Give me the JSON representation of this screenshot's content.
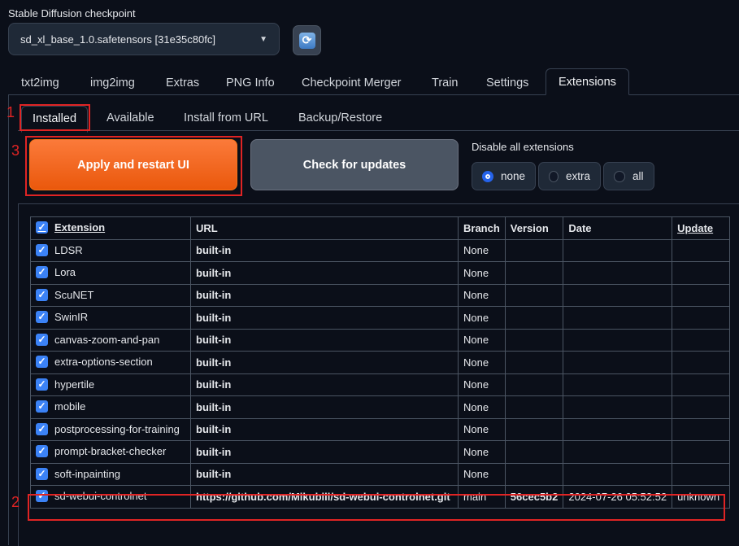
{
  "checkpoint": {
    "label": "Stable Diffusion checkpoint",
    "value": "sd_xl_base_1.0.safetensors [31e35c80fc]",
    "caret": "▼",
    "refresh_icon": "refresh-icon"
  },
  "main_tabs": [
    "txt2img",
    "img2img",
    "Extras",
    "PNG Info",
    "Checkpoint Merger",
    "Train",
    "Settings",
    "Extensions"
  ],
  "sub_tabs": [
    "Installed",
    "Available",
    "Install from URL",
    "Backup/Restore"
  ],
  "annotations": [
    "1",
    "2",
    "3"
  ],
  "buttons": {
    "apply": "Apply and restart UI",
    "check": "Check for updates"
  },
  "disable": {
    "label": "Disable all extensions",
    "options": [
      "none",
      "extra",
      "all"
    ],
    "selected": "none"
  },
  "table": {
    "headers": [
      "Extension",
      "URL",
      "Branch",
      "Version",
      "Date",
      "Update"
    ],
    "rows": [
      {
        "name": "LDSR",
        "url": "built-in",
        "branch": "None",
        "version": "",
        "date": "",
        "update": ""
      },
      {
        "name": "Lora",
        "url": "built-in",
        "branch": "None",
        "version": "",
        "date": "",
        "update": ""
      },
      {
        "name": "ScuNET",
        "url": "built-in",
        "branch": "None",
        "version": "",
        "date": "",
        "update": ""
      },
      {
        "name": "SwinIR",
        "url": "built-in",
        "branch": "None",
        "version": "",
        "date": "",
        "update": ""
      },
      {
        "name": "canvas-zoom-and-pan",
        "url": "built-in",
        "branch": "None",
        "version": "",
        "date": "",
        "update": ""
      },
      {
        "name": "extra-options-section",
        "url": "built-in",
        "branch": "None",
        "version": "",
        "date": "",
        "update": ""
      },
      {
        "name": "hypertile",
        "url": "built-in",
        "branch": "None",
        "version": "",
        "date": "",
        "update": ""
      },
      {
        "name": "mobile",
        "url": "built-in",
        "branch": "None",
        "version": "",
        "date": "",
        "update": ""
      },
      {
        "name": "postprocessing-for-training",
        "url": "built-in",
        "branch": "None",
        "version": "",
        "date": "",
        "update": ""
      },
      {
        "name": "prompt-bracket-checker",
        "url": "built-in",
        "branch": "None",
        "version": "",
        "date": "",
        "update": ""
      },
      {
        "name": "soft-inpainting",
        "url": "built-in",
        "branch": "None",
        "version": "",
        "date": "",
        "update": ""
      },
      {
        "name": "sd-webui-controlnet",
        "url": "https://github.com/Mikubill/sd-webui-controlnet.git",
        "branch": "main",
        "version": "56cec5b2",
        "date": "2024-07-26 05:52:52",
        "update": "unknown"
      }
    ]
  },
  "colors": {
    "accent_orange": "#ea580c",
    "highlight_red": "#e02424",
    "checkbox_blue": "#3b82f6"
  }
}
